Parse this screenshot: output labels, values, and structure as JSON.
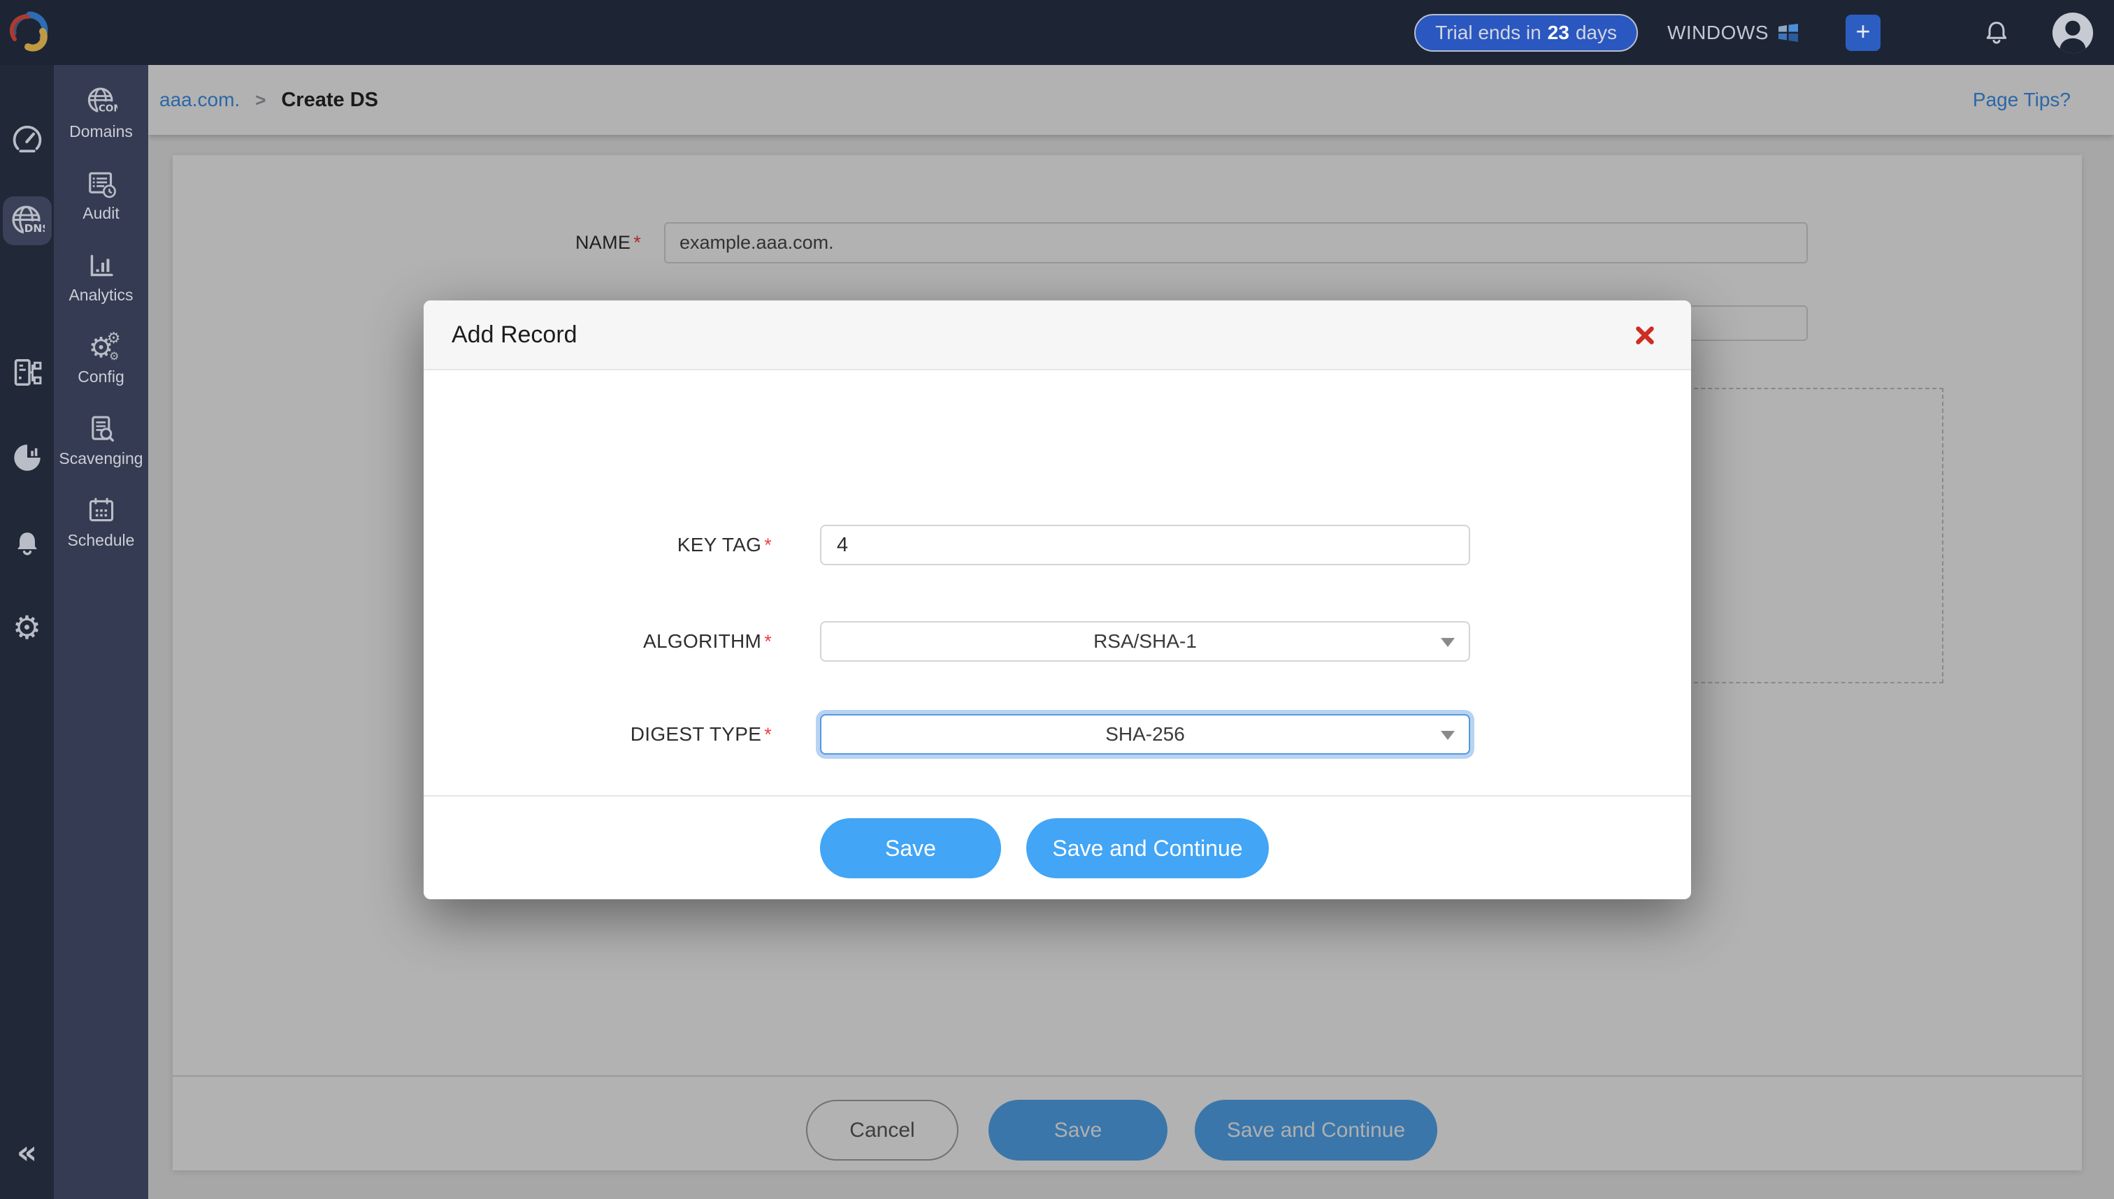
{
  "topbar": {
    "trial_prefix": "Trial ends in",
    "trial_days": "23",
    "trial_suffix": "days",
    "platform": "WINDOWS",
    "add_label": "+"
  },
  "sidebar": {
    "collapse": "«",
    "items": [
      {
        "label": "Domains"
      },
      {
        "label": "Audit"
      },
      {
        "label": "Analytics"
      },
      {
        "label": "Config"
      },
      {
        "label": "Scavenging"
      },
      {
        "label": "Schedule"
      }
    ]
  },
  "breadcrumb": {
    "parent": "aaa.com.",
    "separator": ">",
    "current": "Create DS",
    "page_tips": "Page Tips?"
  },
  "page_form": {
    "name_label": "NAME",
    "required": "*",
    "name_value": "example.aaa.com.",
    "footer": {
      "cancel": "Cancel",
      "save": "Save",
      "save_continue": "Save and Continue"
    }
  },
  "modal": {
    "title": "Add Record",
    "required": "*",
    "fields": [
      {
        "label": "KEY TAG",
        "value": "4"
      },
      {
        "label": "ALGORITHM",
        "value": "RSA/SHA-1"
      },
      {
        "label": "DIGEST TYPE",
        "value": "SHA-256"
      }
    ],
    "buttons": {
      "save": "Save",
      "save_continue": "Save and Continue"
    }
  },
  "icons": {
    "rail": [
      "dashboard-gauge",
      "dns-globe",
      "server-network",
      "pie-report",
      "bell",
      "gear-wrench"
    ],
    "subnav": [
      "domains-globe-com",
      "audit-log-clock",
      "analytics-bars",
      "config-gears",
      "scavenging-doc-search",
      "schedule-calendar"
    ],
    "gear_glyph": "⚙",
    "collapse_glyph": "«"
  },
  "colors": {
    "topbar_bg": "#1d2434",
    "rail_bg": "#212838",
    "subnav_bg": "#343b52",
    "trial_pill_blue": "#2a57c0",
    "modal_button_blue": "#42a5f5",
    "page_button_blue": "#53a9f4",
    "link_blue": "#3f94ef",
    "danger_red": "#cf2d23",
    "required_red": "#ef4040",
    "focus_blue": "#5598dd"
  }
}
